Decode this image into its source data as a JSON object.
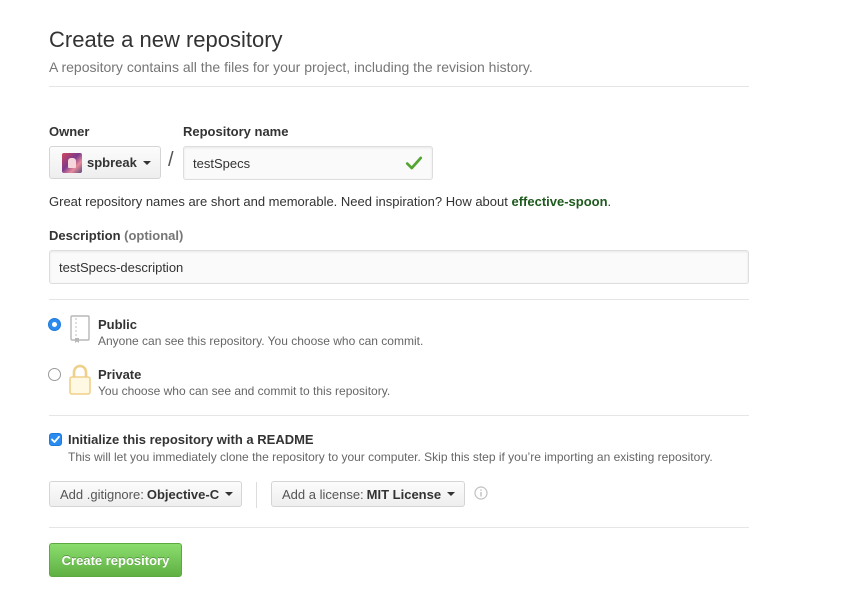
{
  "header": {
    "title": "Create a new repository",
    "subtitle": "A repository contains all the files for your project, including the revision history."
  },
  "owner": {
    "label": "Owner",
    "value": "spbreak",
    "icons": {
      "avatar": "user-avatar",
      "caret": "caret-down-icon"
    }
  },
  "repo_name": {
    "label": "Repository name",
    "value": "testSpecs",
    "separator": "/",
    "valid_icon": "check-icon",
    "valid_color": "#55a532"
  },
  "name_hint": {
    "text": "Great repository names are short and memorable. Need inspiration? How about ",
    "suggestion": "effective-spoon",
    "suffix": "."
  },
  "description": {
    "label": "Description",
    "optional": "(optional)",
    "value": "testSpecs-description"
  },
  "visibility": {
    "selected": "public",
    "options": [
      {
        "id": "public",
        "title": "Public",
        "description": "Anyone can see this repository. You choose who can commit.",
        "icon": "book-icon"
      },
      {
        "id": "private",
        "title": "Private",
        "description": "You choose who can see and commit to this repository.",
        "icon": "lock-icon"
      }
    ]
  },
  "readme": {
    "checked": true,
    "label": "Initialize this repository with a README",
    "description": "This will let you immediately clone the repository to your computer. Skip this step if you’re importing an existing repository."
  },
  "gitignore": {
    "prefix": "Add .gitignore:",
    "value": "Objective-C"
  },
  "license": {
    "prefix": "Add a license:",
    "value": "MIT License",
    "info_icon": "info-icon"
  },
  "submit": {
    "label": "Create repository",
    "color": "#60b044"
  },
  "colors": {
    "accent": "#2a8cf0",
    "suggestion": "#1e5a1e",
    "lock": "#f0d089"
  }
}
